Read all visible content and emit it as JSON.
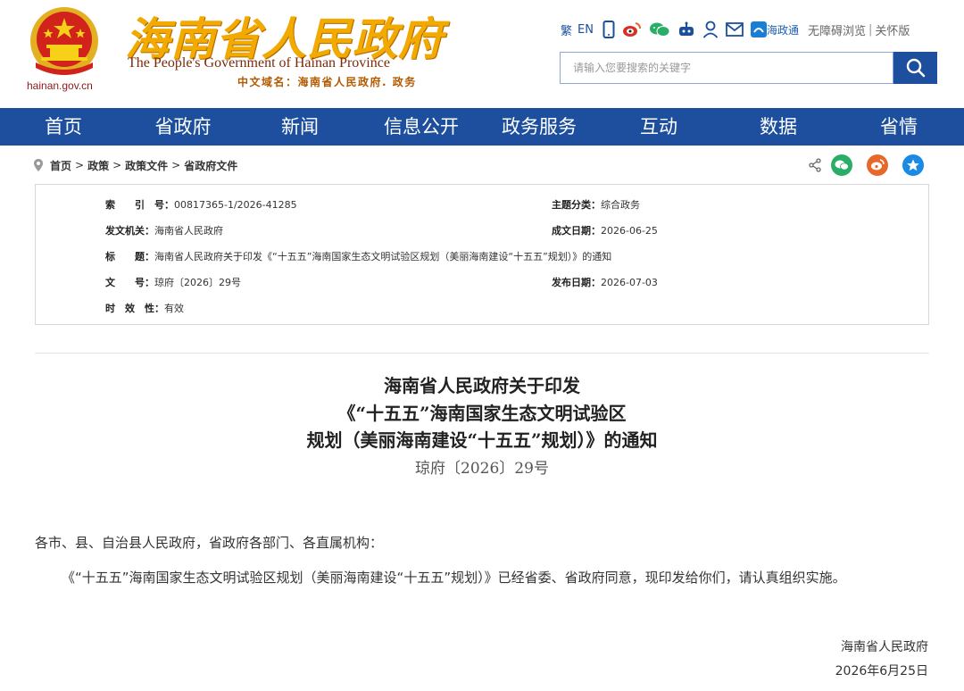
{
  "header": {
    "title_cn": "海南省人民政府",
    "title_en": "The People's Government  of Hainan Province",
    "domain_cn": "中文域名：海南省人民政府. 政务",
    "domain_en": "hainan.gov.cn",
    "tools": {
      "traditional": "繁",
      "english": "EN",
      "haizhengtong": "海政通",
      "accessible": "无障碍浏览",
      "care": "关怀版"
    },
    "search_placeholder": "请输入您要搜索的关键字"
  },
  "nav": [
    "首页",
    "省政府",
    "新闻",
    "信息公开",
    "政务服务",
    "互动",
    "数据",
    "省情"
  ],
  "breadcrumb": [
    "首页",
    "政策",
    "政策文件",
    "省政府文件"
  ],
  "info": {
    "index_key": "索　　引　号：",
    "index_val": "00817365-1/2026-41285",
    "category_key": "主题分类：",
    "category_val": "综合政务",
    "issuer_key": "发文机关：",
    "issuer_val": "海南省人民政府",
    "date_key": "成文日期：",
    "date_val": "2026-06-25",
    "title_key": "标　　题：",
    "title_val": "海南省人民政府关于印发《“十五五”海南国家生态文明试验区规划（美丽海南建设“十五五”规划）》的通知",
    "docno_key": "文　　号：",
    "docno_val": "琼府〔2026〕29号",
    "pubdate_key": "发布日期：",
    "pubdate_val": "2026-07-03",
    "validity_key": "时　效　性：",
    "validity_val": "有效"
  },
  "document": {
    "title_line1": "海南省人民政府关于印发",
    "title_line2": "《“十五五”海南国家生态文明试验区",
    "title_line3": "规划（美丽海南建设“十五五”规划）》的通知",
    "doc_number": "琼府〔2026〕29号",
    "salutation": "各市、县、自治县人民政府，省政府各部门、各直属机构：",
    "paragraph1": "《“十五五”海南国家生态文明试验区规划（美丽海南建设“十五五”规划）》已经省委、省政府同意，现印发给你们，请认真组织实施。",
    "signer": "海南省人民政府",
    "sign_date": "2026年6月25日"
  },
  "colors": {
    "nav_bg": "#1d4f9e",
    "title_gold": "#f2a900",
    "wechat": "#2aae67",
    "weibo": "#e6692b",
    "favorite": "#1a8ae5"
  }
}
